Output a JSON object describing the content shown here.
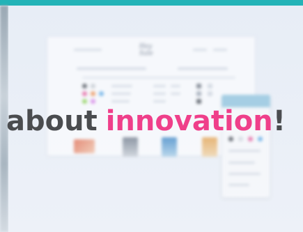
{
  "headline": {
    "part1": "about",
    "part2": "innovation",
    "part3": "!"
  },
  "mockup": {
    "logo_text": "Hey Sale"
  },
  "colors": {
    "top_bar": "#23b3b7",
    "headline_dark": "#4a4c4f",
    "headline_accent": "#ef3f8a",
    "background": "#e9eef5"
  }
}
